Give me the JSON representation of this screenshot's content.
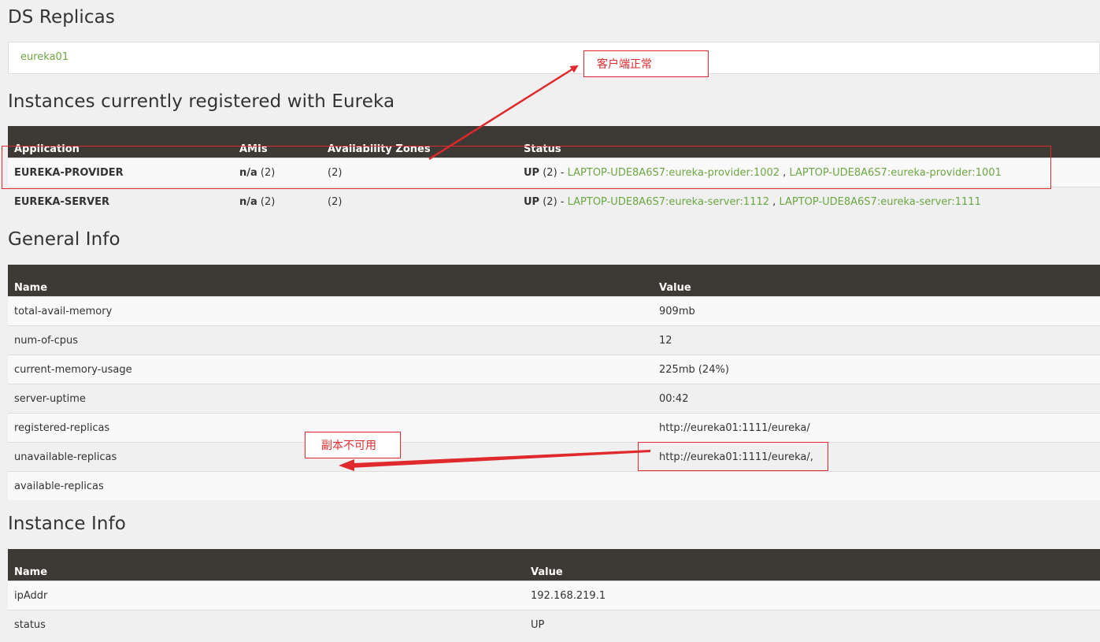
{
  "replicas": {
    "title": "DS Replicas",
    "link": "eureka01"
  },
  "instances": {
    "title": "Instances currently registered with Eureka",
    "headers": [
      "Application",
      "AMIs",
      "Availability Zones",
      "Status"
    ],
    "rows": [
      {
        "app": "EUREKA-PROVIDER",
        "amis_bold": "n/a",
        "amis_count": " (2)",
        "zones": "(2)",
        "status_bold": "UP",
        "status_count": " (2) - ",
        "inst1": "LAPTOP-UDE8A6S7:eureka-provider:1002",
        "sep": " , ",
        "inst2": "LAPTOP-UDE8A6S7:eureka-provider:1001"
      },
      {
        "app": "EUREKA-SERVER",
        "amis_bold": "n/a",
        "amis_count": " (2)",
        "zones": "(2)",
        "status_bold": "UP",
        "status_count": " (2) - ",
        "inst1": "LAPTOP-UDE8A6S7:eureka-server:1112",
        "sep": " , ",
        "inst2": "LAPTOP-UDE8A6S7:eureka-server:1111"
      }
    ]
  },
  "general": {
    "title": "General Info",
    "headers": [
      "Name",
      "Value"
    ],
    "rows": [
      {
        "name": "total-avail-memory",
        "value": "909mb"
      },
      {
        "name": "num-of-cpus",
        "value": "12"
      },
      {
        "name": "current-memory-usage",
        "value": "225mb (24%)"
      },
      {
        "name": "server-uptime",
        "value": "00:42"
      },
      {
        "name": "registered-replicas",
        "value": "http://eureka01:1111/eureka/"
      },
      {
        "name": "unavailable-replicas",
        "value": "http://eureka01:1111/eureka/,"
      },
      {
        "name": "available-replicas",
        "value": ""
      }
    ]
  },
  "instance_info": {
    "title": "Instance Info",
    "headers": [
      "Name",
      "Value"
    ],
    "rows": [
      {
        "name": "ipAddr",
        "value": "192.168.219.1"
      },
      {
        "name": "status",
        "value": "UP"
      }
    ]
  },
  "annotations": {
    "client_ok": "客户端正常",
    "replica_unavailable": "副本不可用",
    "color": "#e0292d"
  },
  "colors": {
    "link": "#6ca643",
    "header_bg": "#3d3934",
    "page_bg": "#f0f0f0"
  }
}
